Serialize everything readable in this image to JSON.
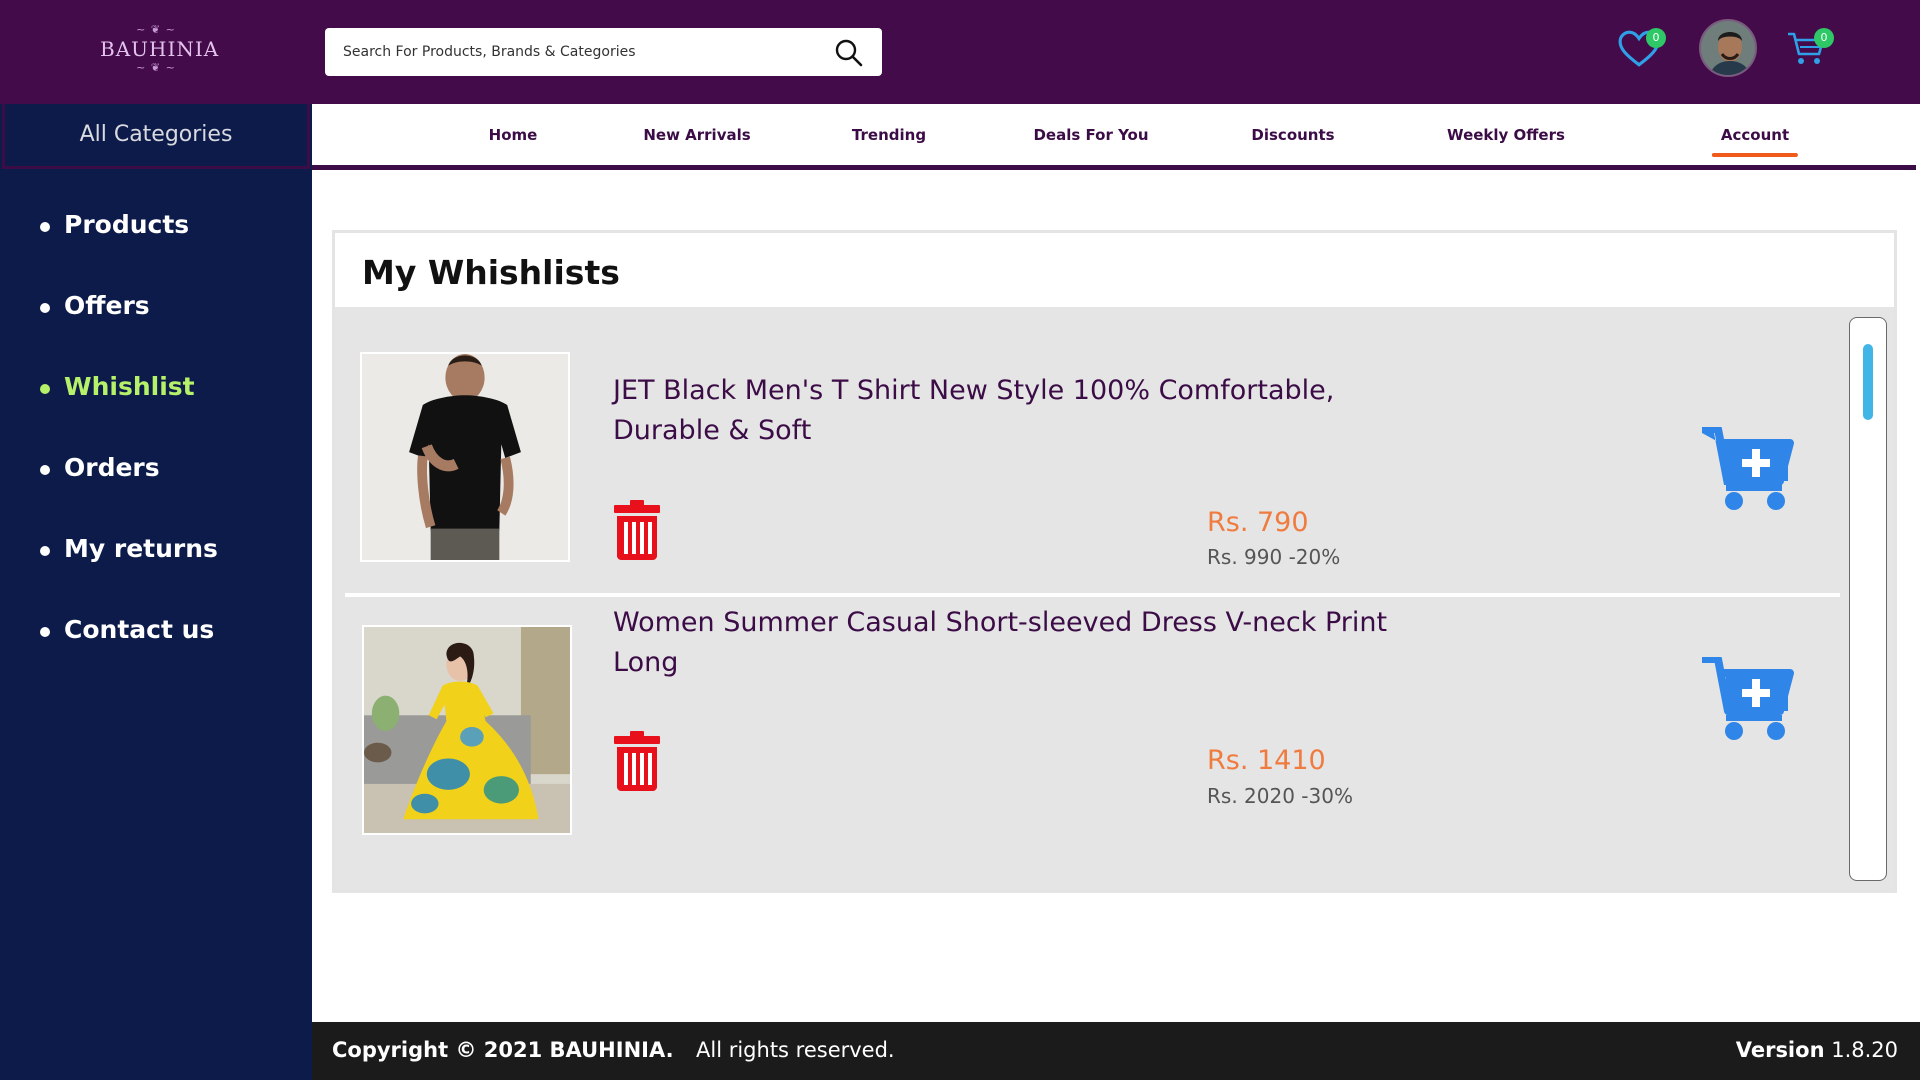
{
  "brand": {
    "name": "BAUHINIA",
    "color": "#430b49"
  },
  "search": {
    "placeholder": "Search For Products, Brands & Categories"
  },
  "header": {
    "wishlist_count": "0",
    "cart_count": "0"
  },
  "sidebar": {
    "heading": "All Categories",
    "items": [
      {
        "label": "Products"
      },
      {
        "label": "Offers"
      },
      {
        "label": "Whishlist",
        "active": true
      },
      {
        "label": "Orders"
      },
      {
        "label": "My returns"
      },
      {
        "label": "Contact us"
      }
    ]
  },
  "nav": {
    "items": [
      {
        "label": "Home"
      },
      {
        "label": "New Arrivals"
      },
      {
        "label": "Trending"
      },
      {
        "label": "Deals For You"
      },
      {
        "label": "Discounts"
      },
      {
        "label": "Weekly Offers"
      },
      {
        "label": "Account",
        "active": true
      }
    ]
  },
  "wishlist": {
    "title": "My Whishlists",
    "items": [
      {
        "title": "JET Black Men's T Shirt New Style 100% Comfortable, Durable & Soft",
        "price": "Rs. 790",
        "old_price": "Rs. 990 -20%"
      },
      {
        "title": "Women Summer Casual Short-sleeved Dress V-neck Print Long",
        "price": "Rs. 1410",
        "old_price": "Rs. 2020 -30%"
      }
    ]
  },
  "footer": {
    "copyright": "Copyright  ©  2021  BAUHINIA.",
    "rights": "All rights reserved.",
    "version_label": "Version",
    "version": "1.8.20"
  },
  "colors": {
    "topbar": "#430b49",
    "sidebar": "#0c1b4a",
    "active_side": "#b6f16a",
    "price": "#f07b3f",
    "cart_icon": "#2f86e8",
    "trash_icon": "#e8101a",
    "badge": "#2ec866",
    "nav_underline": "#f05a1a"
  }
}
